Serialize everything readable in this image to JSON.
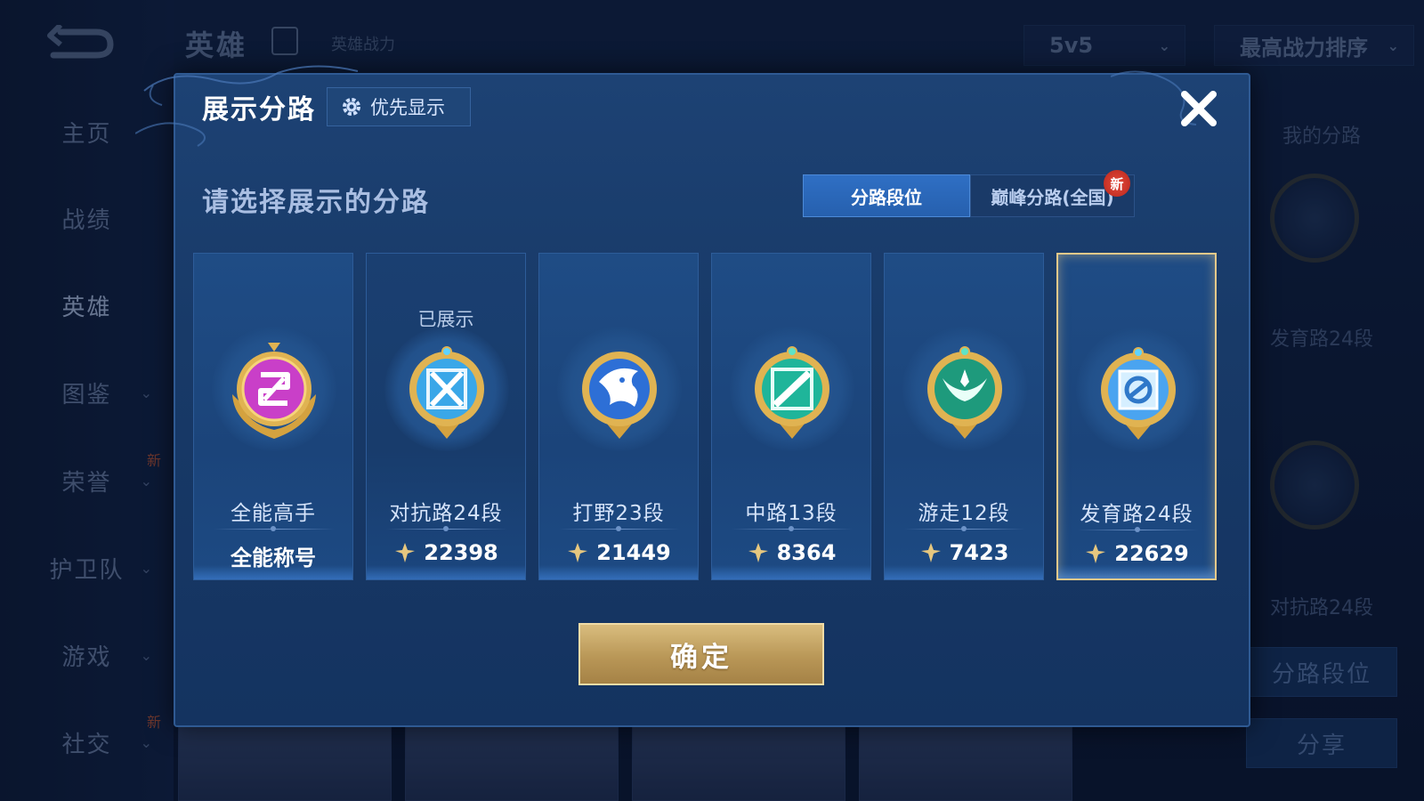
{
  "background": {
    "sidebar": {
      "items": [
        {
          "label": "主页"
        },
        {
          "label": "战绩"
        },
        {
          "label": "英雄"
        },
        {
          "label": "图鉴"
        },
        {
          "label": "荣誉",
          "badge": "新"
        },
        {
          "label": "护卫队"
        },
        {
          "label": "游戏"
        },
        {
          "label": "社交",
          "badge": "新"
        }
      ]
    },
    "header": {
      "title": "英雄",
      "subtitle": "英雄战力",
      "mode_select": "5v5",
      "sort_select": "最高战力排序"
    },
    "right_panel": {
      "title": "我的分路",
      "lane1": "发育路24段",
      "lane2": "对抗路24段",
      "lane_button": "分路段位",
      "share_button": "分享"
    }
  },
  "modal": {
    "title": "展示分路",
    "priority_button": "优先显示",
    "prompt": "请选择展示的分路",
    "tabs": [
      {
        "label": "分路段位",
        "active": true
      },
      {
        "label": "巅峰分路(全国)",
        "badge": "新"
      }
    ],
    "cards": [
      {
        "rank": "全能高手",
        "power": "全能称号",
        "shown_label": "",
        "medal": "all-round-medal",
        "accent": "#c93fc8",
        "selected": false
      },
      {
        "rank": "对抗路24段",
        "power": "22398",
        "shown_label": "已展示",
        "medal": "clash-lane-medal",
        "accent": "#3aa7e8",
        "selected": false
      },
      {
        "rank": "打野23段",
        "power": "21449",
        "shown_label": "",
        "medal": "jungle-medal",
        "accent": "#2d6fd6",
        "selected": false
      },
      {
        "rank": "中路13段",
        "power": "8364",
        "shown_label": "",
        "medal": "mid-lane-medal",
        "accent": "#1fb59a",
        "selected": false
      },
      {
        "rank": "游走12段",
        "power": "7423",
        "shown_label": "",
        "medal": "roam-medal",
        "accent": "#1e9a7c",
        "selected": false
      },
      {
        "rank": "发育路24段",
        "power": "22629",
        "shown_label": "",
        "medal": "farm-lane-medal",
        "accent": "#4aa4f0",
        "selected": true
      }
    ],
    "confirm_button": "确定"
  },
  "colors": {
    "gold": "#e5c98a",
    "tab_active": "#2f6fc4",
    "modal_bg": "#1d4274"
  }
}
